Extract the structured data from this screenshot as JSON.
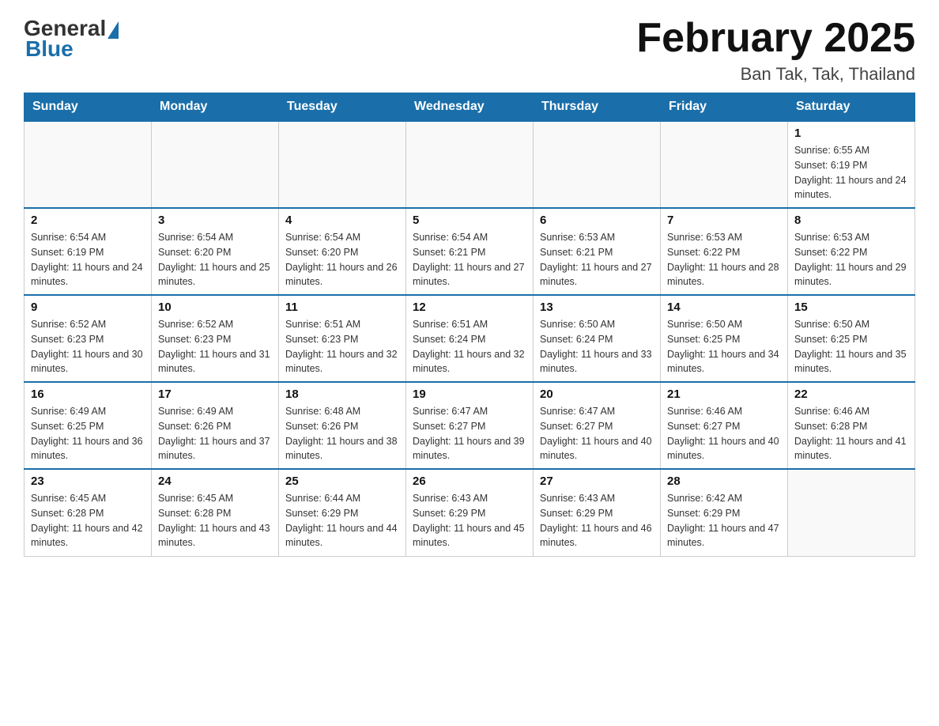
{
  "header": {
    "logo_general": "General",
    "logo_blue": "Blue",
    "month_title": "February 2025",
    "location": "Ban Tak, Tak, Thailand"
  },
  "days_of_week": [
    "Sunday",
    "Monday",
    "Tuesday",
    "Wednesday",
    "Thursday",
    "Friday",
    "Saturday"
  ],
  "weeks": [
    [
      {
        "day": "",
        "info": ""
      },
      {
        "day": "",
        "info": ""
      },
      {
        "day": "",
        "info": ""
      },
      {
        "day": "",
        "info": ""
      },
      {
        "day": "",
        "info": ""
      },
      {
        "day": "",
        "info": ""
      },
      {
        "day": "1",
        "info": "Sunrise: 6:55 AM\nSunset: 6:19 PM\nDaylight: 11 hours and 24 minutes."
      }
    ],
    [
      {
        "day": "2",
        "info": "Sunrise: 6:54 AM\nSunset: 6:19 PM\nDaylight: 11 hours and 24 minutes."
      },
      {
        "day": "3",
        "info": "Sunrise: 6:54 AM\nSunset: 6:20 PM\nDaylight: 11 hours and 25 minutes."
      },
      {
        "day": "4",
        "info": "Sunrise: 6:54 AM\nSunset: 6:20 PM\nDaylight: 11 hours and 26 minutes."
      },
      {
        "day": "5",
        "info": "Sunrise: 6:54 AM\nSunset: 6:21 PM\nDaylight: 11 hours and 27 minutes."
      },
      {
        "day": "6",
        "info": "Sunrise: 6:53 AM\nSunset: 6:21 PM\nDaylight: 11 hours and 27 minutes."
      },
      {
        "day": "7",
        "info": "Sunrise: 6:53 AM\nSunset: 6:22 PM\nDaylight: 11 hours and 28 minutes."
      },
      {
        "day": "8",
        "info": "Sunrise: 6:53 AM\nSunset: 6:22 PM\nDaylight: 11 hours and 29 minutes."
      }
    ],
    [
      {
        "day": "9",
        "info": "Sunrise: 6:52 AM\nSunset: 6:23 PM\nDaylight: 11 hours and 30 minutes."
      },
      {
        "day": "10",
        "info": "Sunrise: 6:52 AM\nSunset: 6:23 PM\nDaylight: 11 hours and 31 minutes."
      },
      {
        "day": "11",
        "info": "Sunrise: 6:51 AM\nSunset: 6:23 PM\nDaylight: 11 hours and 32 minutes."
      },
      {
        "day": "12",
        "info": "Sunrise: 6:51 AM\nSunset: 6:24 PM\nDaylight: 11 hours and 32 minutes."
      },
      {
        "day": "13",
        "info": "Sunrise: 6:50 AM\nSunset: 6:24 PM\nDaylight: 11 hours and 33 minutes."
      },
      {
        "day": "14",
        "info": "Sunrise: 6:50 AM\nSunset: 6:25 PM\nDaylight: 11 hours and 34 minutes."
      },
      {
        "day": "15",
        "info": "Sunrise: 6:50 AM\nSunset: 6:25 PM\nDaylight: 11 hours and 35 minutes."
      }
    ],
    [
      {
        "day": "16",
        "info": "Sunrise: 6:49 AM\nSunset: 6:25 PM\nDaylight: 11 hours and 36 minutes."
      },
      {
        "day": "17",
        "info": "Sunrise: 6:49 AM\nSunset: 6:26 PM\nDaylight: 11 hours and 37 minutes."
      },
      {
        "day": "18",
        "info": "Sunrise: 6:48 AM\nSunset: 6:26 PM\nDaylight: 11 hours and 38 minutes."
      },
      {
        "day": "19",
        "info": "Sunrise: 6:47 AM\nSunset: 6:27 PM\nDaylight: 11 hours and 39 minutes."
      },
      {
        "day": "20",
        "info": "Sunrise: 6:47 AM\nSunset: 6:27 PM\nDaylight: 11 hours and 40 minutes."
      },
      {
        "day": "21",
        "info": "Sunrise: 6:46 AM\nSunset: 6:27 PM\nDaylight: 11 hours and 40 minutes."
      },
      {
        "day": "22",
        "info": "Sunrise: 6:46 AM\nSunset: 6:28 PM\nDaylight: 11 hours and 41 minutes."
      }
    ],
    [
      {
        "day": "23",
        "info": "Sunrise: 6:45 AM\nSunset: 6:28 PM\nDaylight: 11 hours and 42 minutes."
      },
      {
        "day": "24",
        "info": "Sunrise: 6:45 AM\nSunset: 6:28 PM\nDaylight: 11 hours and 43 minutes."
      },
      {
        "day": "25",
        "info": "Sunrise: 6:44 AM\nSunset: 6:29 PM\nDaylight: 11 hours and 44 minutes."
      },
      {
        "day": "26",
        "info": "Sunrise: 6:43 AM\nSunset: 6:29 PM\nDaylight: 11 hours and 45 minutes."
      },
      {
        "day": "27",
        "info": "Sunrise: 6:43 AM\nSunset: 6:29 PM\nDaylight: 11 hours and 46 minutes."
      },
      {
        "day": "28",
        "info": "Sunrise: 6:42 AM\nSunset: 6:29 PM\nDaylight: 11 hours and 47 minutes."
      },
      {
        "day": "",
        "info": ""
      }
    ]
  ]
}
